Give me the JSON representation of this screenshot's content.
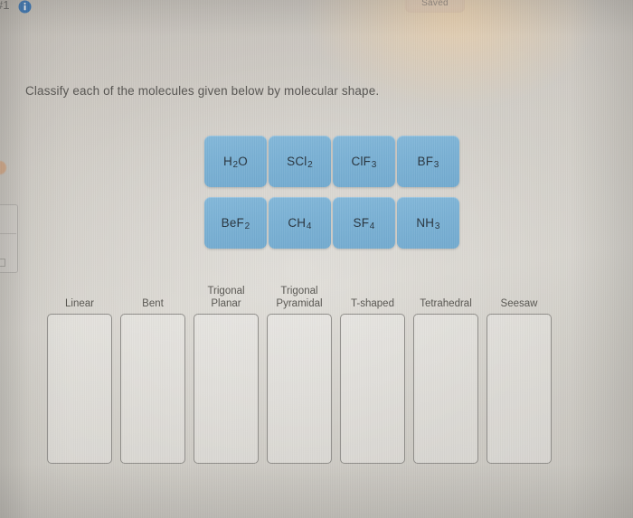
{
  "header": {
    "question_number": "#1",
    "info_icon": "info-circle-icon",
    "saved_status": "Saved"
  },
  "prompt": "Classify each of the molecules given below by molecular shape.",
  "colors": {
    "tile_blue": "#79b0d4",
    "tile_text": "#26323c",
    "background": "#c9c6bf",
    "info_icon_blue": "#2f6fb3",
    "box_border": "#8e8c88",
    "label_text": "#56544f"
  },
  "molecules": [
    [
      {
        "formula": "H",
        "sub1": "2",
        "tail": "O",
        "plain": "H2O"
      },
      {
        "formula": "SCl",
        "sub1": "2",
        "tail": "",
        "plain": "SCl2"
      },
      {
        "formula": "ClF",
        "sub1": "3",
        "tail": "",
        "plain": "ClF3"
      },
      {
        "formula": "BF",
        "sub1": "3",
        "tail": "",
        "plain": "BF3"
      }
    ],
    [
      {
        "formula": "BeF",
        "sub1": "2",
        "tail": "",
        "plain": "BeF2"
      },
      {
        "formula": "CH",
        "sub1": "4",
        "tail": "",
        "plain": "CH4"
      },
      {
        "formula": "SF",
        "sub1": "4",
        "tail": "",
        "plain": "SF4"
      },
      {
        "formula": "NH",
        "sub1": "3",
        "tail": "",
        "plain": "NH3"
      }
    ]
  ],
  "categories": [
    {
      "line1": "Linear",
      "line2": "",
      "contents": []
    },
    {
      "line1": "Bent",
      "line2": "",
      "contents": []
    },
    {
      "line1": "Trigonal",
      "line2": "Planar",
      "contents": []
    },
    {
      "line1": "Trigonal",
      "line2": "Pyramidal",
      "contents": []
    },
    {
      "line1": "T-shaped",
      "line2": "",
      "contents": []
    },
    {
      "line1": "Tetrahedral",
      "line2": "",
      "contents": []
    },
    {
      "line1": "Seesaw",
      "line2": "",
      "contents": []
    }
  ]
}
